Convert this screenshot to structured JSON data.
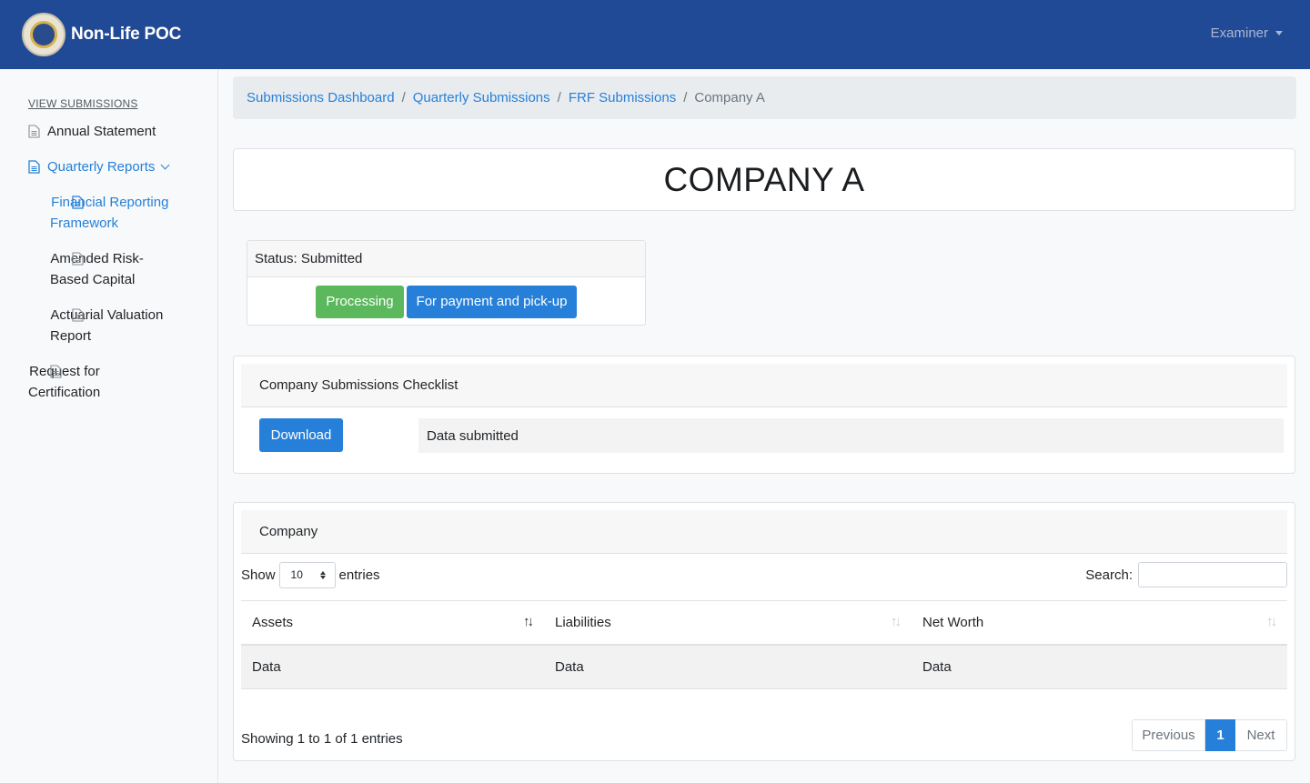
{
  "navbar": {
    "title": "Non-Life POC",
    "user_label": "Examiner"
  },
  "sidebar": {
    "heading": "VIEW SUBMISSIONS",
    "items": [
      {
        "label": "Annual Statement"
      },
      {
        "label": "Quarterly Reports"
      },
      {
        "label": "Financial Reporting Framework"
      },
      {
        "label": "Amended Risk-Based Capital"
      },
      {
        "label": "Actuarial Valuation Report"
      },
      {
        "label": "Request for Certification"
      }
    ]
  },
  "breadcrumb": {
    "items": [
      "Submissions Dashboard",
      "Quarterly Submissions",
      "FRF Submissions"
    ],
    "separator": "/",
    "current": "Company A"
  },
  "page": {
    "title": "COMPANY A"
  },
  "status": {
    "label": "Status: Submitted",
    "btn_processing": "Processing",
    "btn_payment": "For payment and pick-up"
  },
  "checklist": {
    "header": "Company Submissions Checklist",
    "download_label": "Download",
    "note": "Data submitted"
  },
  "company_table": {
    "header": "Company",
    "show_label": "Show",
    "entries_value": "10",
    "entries_label": "entries",
    "search_label": "Search:",
    "columns": [
      "Assets",
      "Liabilities",
      "Net Worth"
    ],
    "rows": [
      [
        "Data",
        "Data",
        "Data"
      ]
    ],
    "info": "Showing 1 to 1 of 1 entries",
    "pager": {
      "previous": "Previous",
      "current": "1",
      "next": "Next"
    }
  },
  "colors": {
    "navbar": "#214a96",
    "accent": "#2680d9",
    "success": "#5cb85c"
  }
}
